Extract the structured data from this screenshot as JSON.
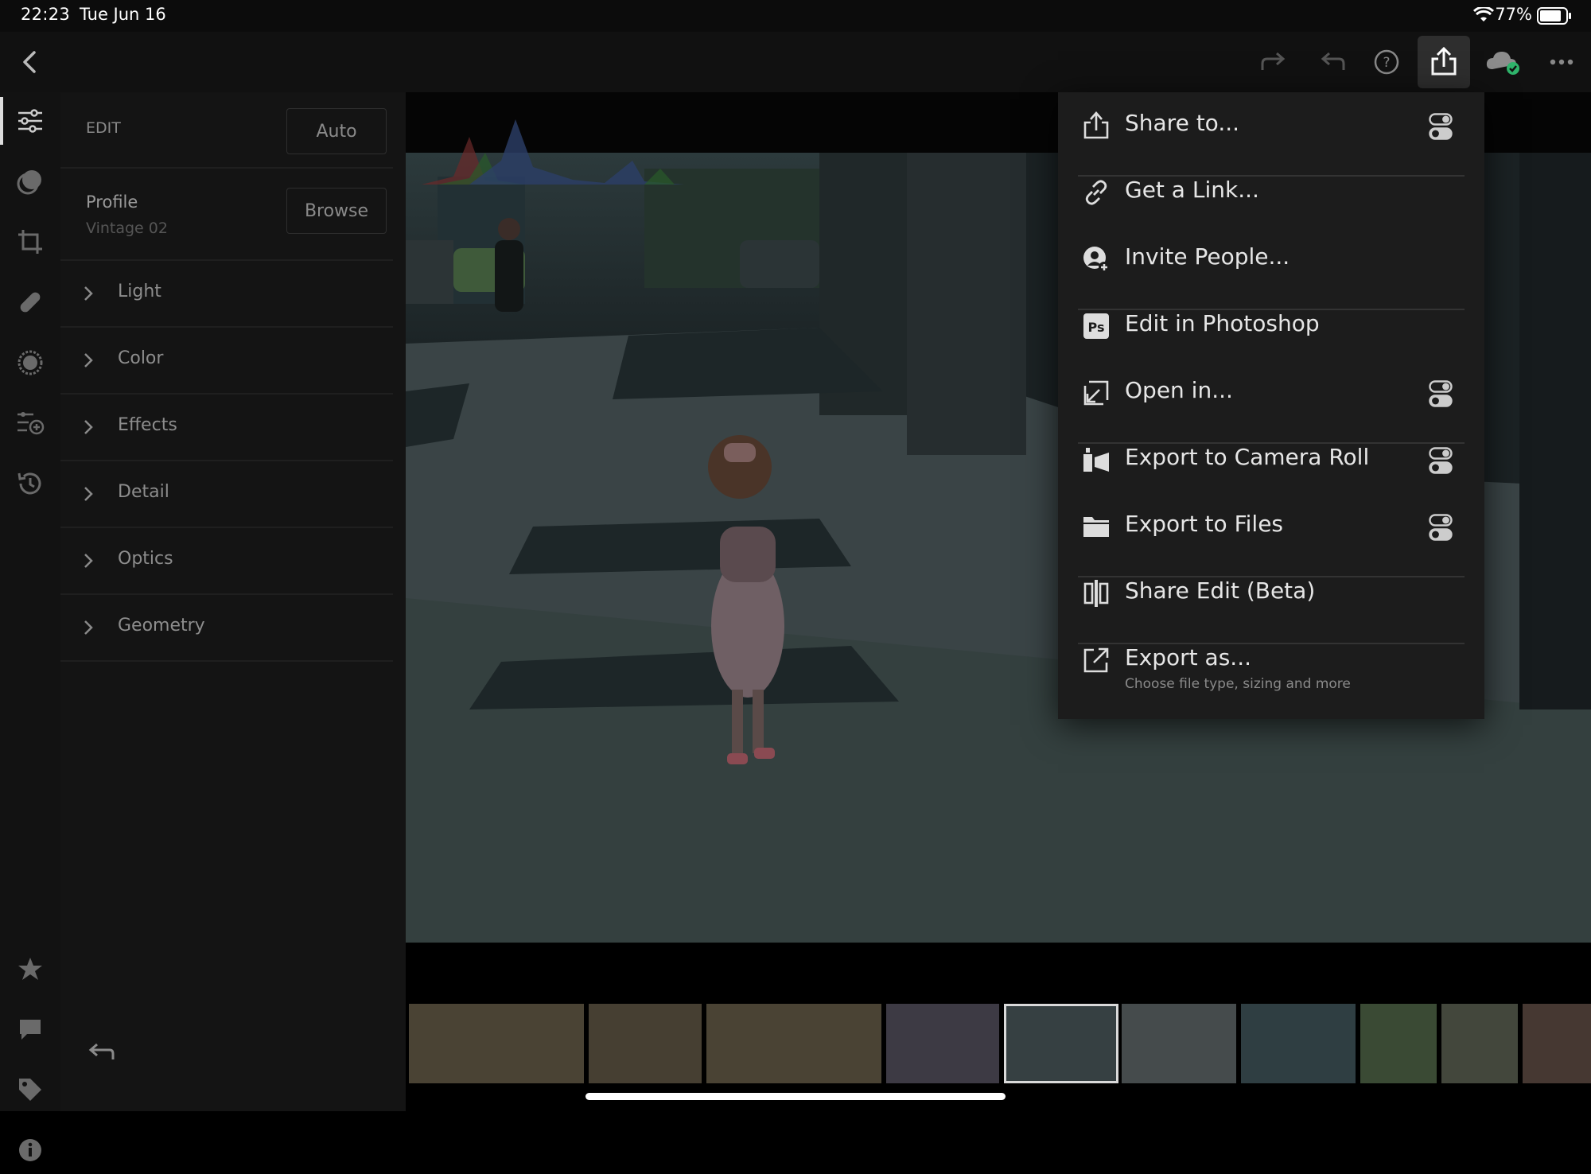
{
  "status_bar": {
    "time": "22:23",
    "date": "Tue Jun 16",
    "battery_pct": "77%"
  },
  "toolbar": {
    "icons": [
      "back-icon",
      "redo-icon",
      "undo-icon",
      "help-icon",
      "share-icon",
      "cloud-synced-icon",
      "more-icon"
    ]
  },
  "rail": {
    "icons": [
      "edit-sliders-icon",
      "presets-icon",
      "crop-icon",
      "healing-icon",
      "masking-icon",
      "versions-icon",
      "history-icon",
      "star-icon",
      "comment-icon",
      "tag-icon",
      "info-icon"
    ]
  },
  "panel": {
    "edit_label": "EDIT",
    "auto_label": "Auto",
    "profile_label": "Profile",
    "profile_value": "Vintage 02",
    "browse_label": "Browse",
    "sections": [
      "Light",
      "Color",
      "Effects",
      "Detail",
      "Optics",
      "Geometry"
    ]
  },
  "menu": {
    "items": [
      {
        "label": "Share to...",
        "icon": "share-icon",
        "options": true
      },
      {
        "label": "Get a Link...",
        "icon": "link-icon",
        "options": false
      },
      {
        "label": "Invite People...",
        "icon": "invite-icon",
        "options": false
      },
      {
        "label": "Edit in Photoshop",
        "icon": "photoshop-icon",
        "options": false
      },
      {
        "label": "Open in...",
        "icon": "open-in-icon",
        "options": true
      },
      {
        "label": "Export to Camera Roll",
        "icon": "camera-roll-icon",
        "options": true
      },
      {
        "label": "Export to Files",
        "icon": "folder-icon",
        "options": true
      },
      {
        "label": "Share Edit (Beta)",
        "icon": "share-edit-icon",
        "options": false
      },
      {
        "label": "Export as...",
        "sublabel": "Choose file type, sizing and more",
        "icon": "export-as-icon",
        "options": false
      }
    ]
  },
  "colors": {
    "accent_sync": "#2fb36b",
    "menu_bg": "#1c1c1c",
    "panel_bg": "#141414"
  }
}
